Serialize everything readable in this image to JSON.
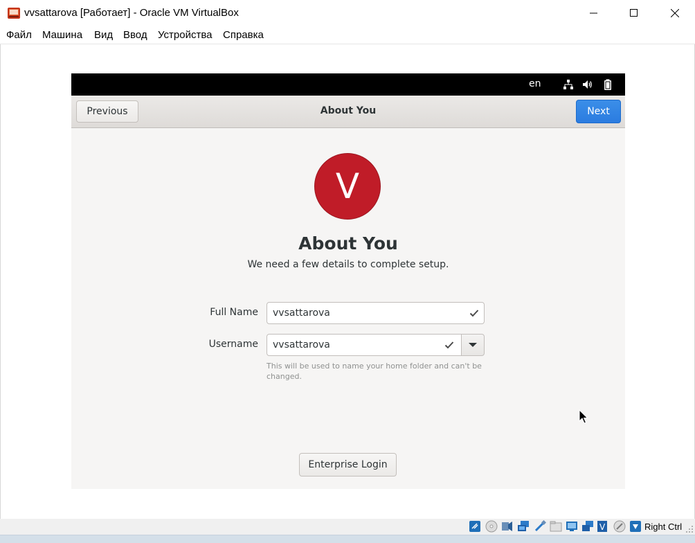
{
  "window": {
    "title": "vvsattarova [Работает] - Oracle VM VirtualBox",
    "icons": {
      "app": "virtualbox-icon",
      "minimize": "minimize-icon",
      "maximize": "maximize-icon",
      "close": "close-icon"
    }
  },
  "menu": {
    "items": [
      "Файл",
      "Машина",
      "Вид",
      "Ввод",
      "Устройства",
      "Справка"
    ]
  },
  "guest": {
    "topbar": {
      "language": "en",
      "icons": [
        "network-icon",
        "volume-icon",
        "battery-icon"
      ]
    },
    "headerbar": {
      "previous_label": "Previous",
      "title": "About You",
      "next_label": "Next"
    },
    "avatar_letter": "V",
    "avatar_color": "#c01c28",
    "page_title": "About You",
    "page_subtitle": "We need a few details to complete setup.",
    "form": {
      "full_name_label": "Full Name",
      "full_name_value": "vvsattarova",
      "username_label": "Username",
      "username_value": "vvsattarova",
      "username_hint": "This will be used to name your home folder and can't be changed."
    },
    "enterprise_login_label": "Enterprise Login",
    "accent_color": "#2b7ce0"
  },
  "statusbar": {
    "icons": [
      "hard-disk-icon",
      "optical-drive-icon",
      "audio-icon",
      "network-adapter-icon",
      "usb-icon",
      "shared-folders-icon",
      "display-icon",
      "video-capture-icon",
      "virtualization-icon",
      "mouse-integration-icon",
      "keyboard-capture-icon"
    ],
    "host_key": "Right Ctrl"
  }
}
